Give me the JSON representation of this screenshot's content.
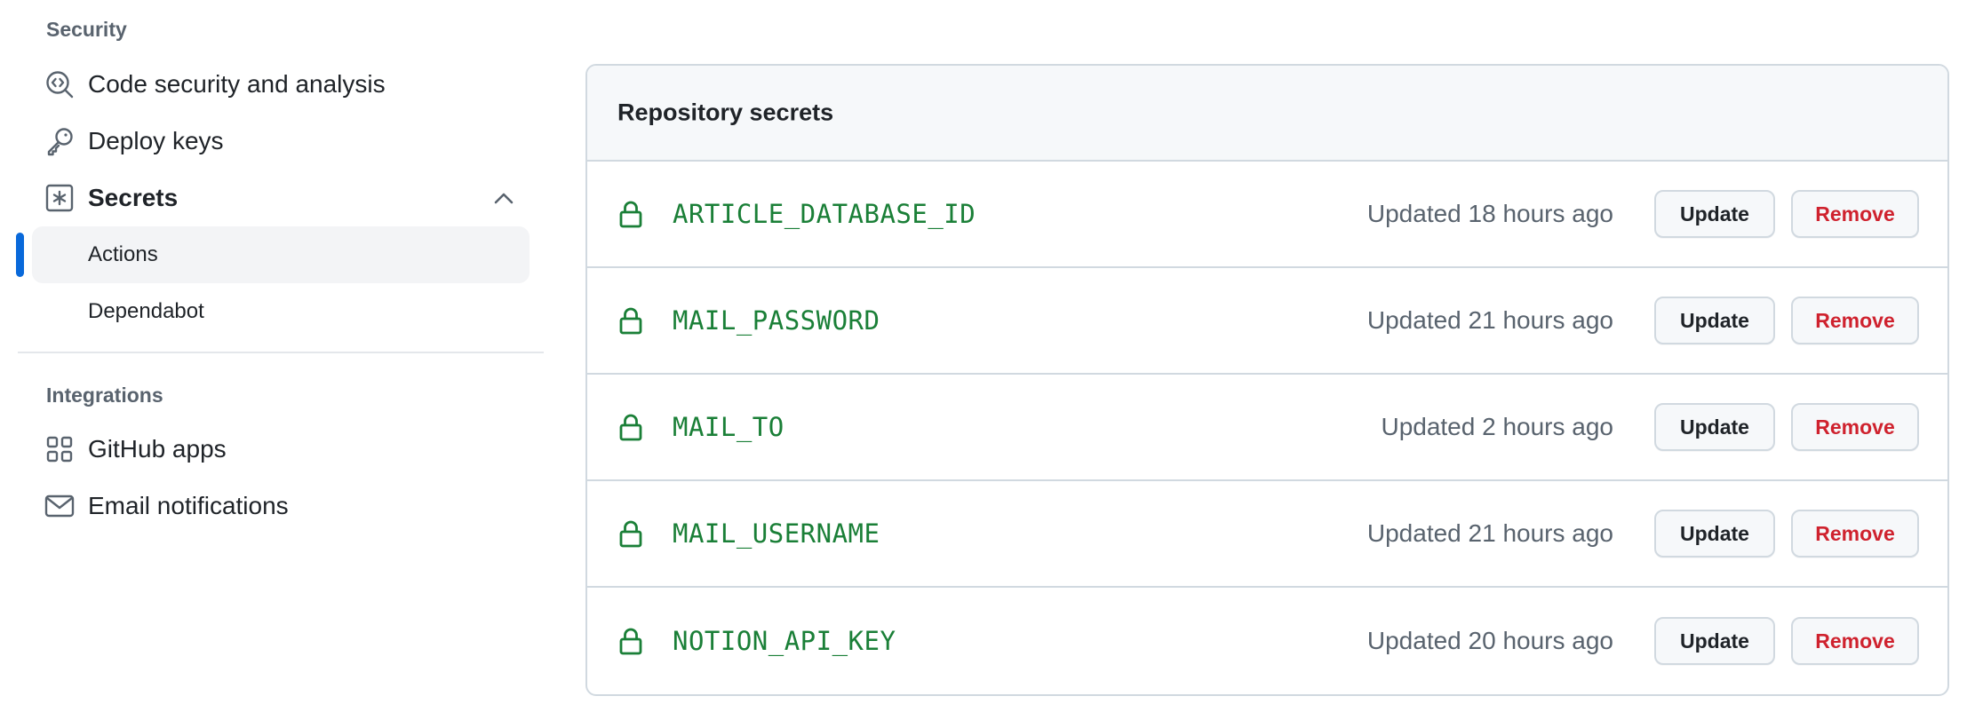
{
  "sidebar": {
    "security_heading": "Security",
    "items": [
      {
        "label": "Code security and analysis",
        "icon": "codescan-icon"
      },
      {
        "label": "Deploy keys",
        "icon": "key-icon"
      },
      {
        "label": "Secrets",
        "icon": "asterisk-icon"
      }
    ],
    "secrets_sub": [
      {
        "label": "Actions",
        "active": true
      },
      {
        "label": "Dependabot",
        "active": false
      }
    ],
    "integrations_heading": "Integrations",
    "integrations": [
      {
        "label": "GitHub apps",
        "icon": "apps-icon"
      },
      {
        "label": "Email notifications",
        "icon": "mail-icon"
      }
    ]
  },
  "secrets_box": {
    "title": "Repository secrets",
    "rows": [
      {
        "name": "ARTICLE_DATABASE_ID",
        "updated": "Updated 18 hours ago",
        "update_label": "Update",
        "remove_label": "Remove"
      },
      {
        "name": "MAIL_PASSWORD",
        "updated": "Updated 21 hours ago",
        "update_label": "Update",
        "remove_label": "Remove"
      },
      {
        "name": "MAIL_TO",
        "updated": "Updated 2 hours ago",
        "update_label": "Update",
        "remove_label": "Remove"
      },
      {
        "name": "MAIL_USERNAME",
        "updated": "Updated 21 hours ago",
        "update_label": "Update",
        "remove_label": "Remove"
      },
      {
        "name": "NOTION_API_KEY",
        "updated": "Updated 20 hours ago",
        "update_label": "Update",
        "remove_label": "Remove"
      }
    ]
  },
  "colors": {
    "accent": "#0969da",
    "secret_green": "#1a7f37",
    "danger_red": "#cf222e",
    "muted_text": "#59636e",
    "border": "#d1d9e0"
  }
}
